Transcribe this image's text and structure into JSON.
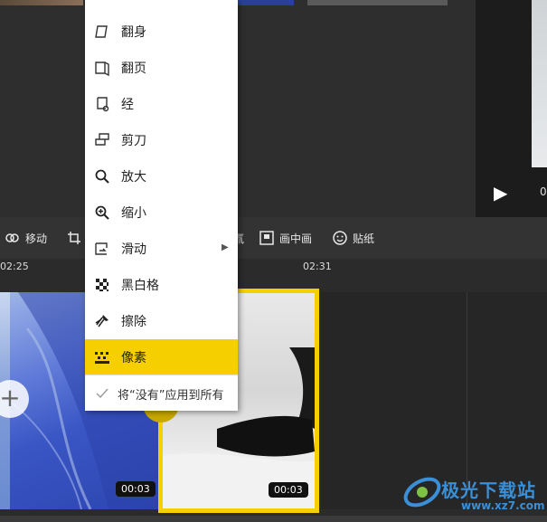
{
  "toolbar": {
    "items": [
      {
        "label": "移动",
        "icon": "move-icon"
      },
      {
        "label": "",
        "icon": "crop-icon"
      },
      {
        "label": "",
        "icon": "filter-icon"
      },
      {
        "label": "画中画",
        "icon": "picture-in-picture-icon"
      },
      {
        "label": "贴纸",
        "icon": "sticker-icon"
      }
    ],
    "fragment_label": "氚"
  },
  "ruler": {
    "labels": [
      "02:25",
      "02:31"
    ]
  },
  "preview": {
    "time_fragment": "0"
  },
  "timeline": {
    "clips": [
      {
        "duration": "00:03",
        "selected": false
      },
      {
        "duration": "00:03",
        "selected": true
      }
    ],
    "add_button": "+"
  },
  "menu": {
    "items": [
      {
        "label": "翻身",
        "icon": "flip-icon"
      },
      {
        "label": "翻页",
        "icon": "page-turn-icon"
      },
      {
        "label": "经",
        "icon": "scroll-icon"
      },
      {
        "label": "剪刀",
        "icon": "scissors-icon"
      },
      {
        "label": "放大",
        "icon": "zoom-in-icon"
      },
      {
        "label": "缩小",
        "icon": "zoom-out-icon"
      },
      {
        "label": "滑动",
        "icon": "slide-icon",
        "has_submenu": true
      },
      {
        "label": "黑白格",
        "icon": "checkerboard-icon"
      },
      {
        "label": "擦除",
        "icon": "erase-icon"
      },
      {
        "label": "像素",
        "icon": "pixel-icon",
        "selected": true
      }
    ],
    "apply_all": "将“没有”应用到所有"
  },
  "watermark": {
    "text": "极光下载站",
    "url": "www.xz7.com"
  },
  "colors": {
    "accent": "#f5cf00",
    "background": "#2b2b2b",
    "toolbar": "#333333",
    "menu": "#ffffff"
  }
}
